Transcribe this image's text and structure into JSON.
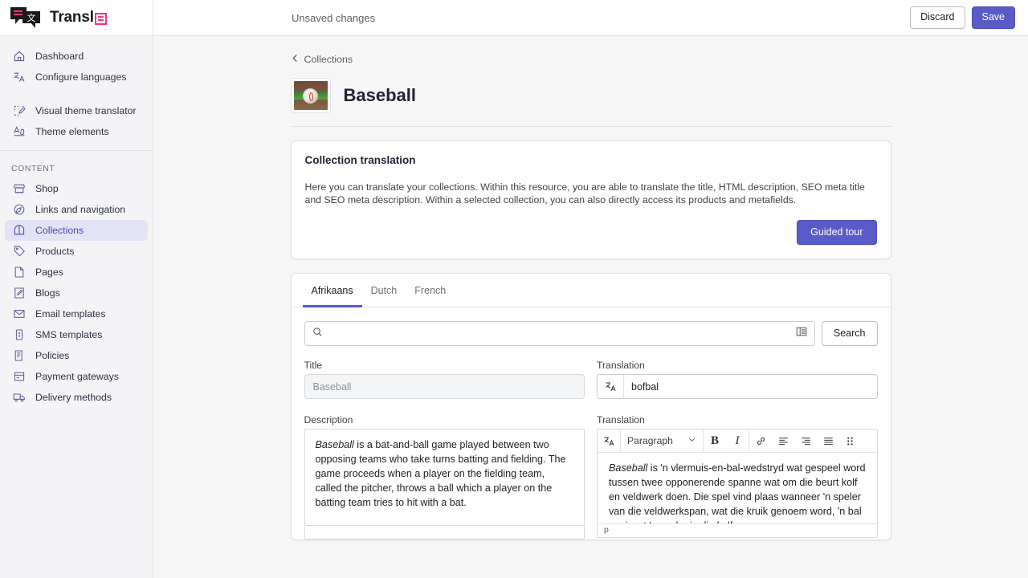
{
  "brand": {
    "name": "Transl",
    "logo_icon": "translate-speech-bubbles-logo",
    "accent_pink": "#f8317f",
    "accent_indigo": "#5a5ac9"
  },
  "sidebar": {
    "primary_items": [
      {
        "label": "Dashboard",
        "icon": "home-icon"
      },
      {
        "label": "Configure languages",
        "icon": "translate-icon"
      }
    ],
    "theme_items": [
      {
        "label": "Visual theme translator",
        "icon": "visual-editor-icon"
      },
      {
        "label": "Theme elements",
        "icon": "typography-icon"
      }
    ],
    "section_title": "CONTENT",
    "content_items": [
      {
        "label": "Shop",
        "icon": "store-icon",
        "active": false
      },
      {
        "label": "Links and navigation",
        "icon": "compass-icon",
        "active": false
      },
      {
        "label": "Collections",
        "icon": "collection-icon",
        "active": true
      },
      {
        "label": "Products",
        "icon": "tag-icon",
        "active": false
      },
      {
        "label": "Pages",
        "icon": "page-icon",
        "active": false
      },
      {
        "label": "Blogs",
        "icon": "blog-pencil-icon",
        "active": false
      },
      {
        "label": "Email templates",
        "icon": "envelope-icon",
        "active": false
      },
      {
        "label": "SMS templates",
        "icon": "phone-icon",
        "active": false
      },
      {
        "label": "Policies",
        "icon": "scroll-icon",
        "active": false
      },
      {
        "label": "Payment gateways",
        "icon": "payment-card-icon",
        "active": false
      },
      {
        "label": "Delivery methods",
        "icon": "truck-icon",
        "active": false
      }
    ]
  },
  "topbar": {
    "status_text": "Unsaved changes",
    "discard_label": "Discard",
    "save_label": "Save"
  },
  "breadcrumb": {
    "back_icon": "chevron-left-icon",
    "label": "Collections"
  },
  "page": {
    "title": "Baseball",
    "thumbnail_alt": "baseball-on-field-thumbnail"
  },
  "info_card": {
    "title": "Collection translation",
    "description": "Here you can translate your collections. Within this resource, you are able to translate the title, HTML description, SEO meta title and SEO meta description. Within a selected collection, you can also directly access its products and metafields.",
    "tour_button": "Guided tour"
  },
  "language_tabs": [
    {
      "label": "Afrikaans",
      "active": true
    },
    {
      "label": "Dutch",
      "active": false
    },
    {
      "label": "French",
      "active": false
    }
  ],
  "search": {
    "icon": "search-icon",
    "value": "",
    "placeholder": "",
    "filter_icon": "list-filter-icon",
    "button_label": "Search"
  },
  "title_field": {
    "label": "Title",
    "value": "Baseball",
    "disabled": true
  },
  "title_translation": {
    "label": "Translation",
    "translate_icon": "translate-icon",
    "value": "bofbal"
  },
  "description_field": {
    "label": "Description",
    "emphasis_word": "Baseball",
    "text": " is a bat-and-ball game played between two opposing teams who take turns batting and fielding. The game proceeds when a player on the fielding team, called the pitcher, throws a ball which a player on the batting team tries to hit with a bat."
  },
  "description_translation": {
    "label": "Translation",
    "toolbar": {
      "translate_icon": "translate-icon",
      "block_format": "Paragraph",
      "chevron_icon": "chevron-down-icon",
      "bold_label": "B",
      "italic_label": "I",
      "link_icon": "link-icon",
      "align_left_icon": "align-left-icon",
      "align_right_icon": "align-right-icon",
      "align_justify_icon": "align-justify-icon",
      "drag_handle_icon": "drag-grid-icon"
    },
    "emphasis_word": "Baseball",
    "text": " is 'n vlermuis-en-bal-wedstryd wat gespeel word tussen twee opponerende spanne wat om die beurt kolf en veldwerk doen. Die spel vind plaas wanneer 'n speler van die veldwerkspan, wat die kruik genoem word, 'n bal gooi wat 'n speler in die kolfspan",
    "status_label": "p"
  }
}
